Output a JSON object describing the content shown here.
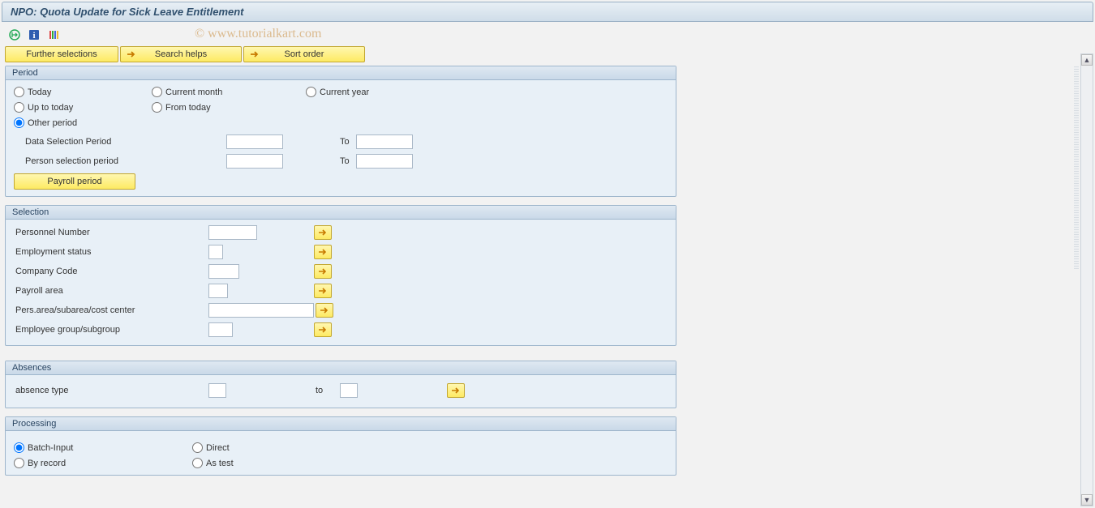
{
  "title": "NPO: Quota Update for Sick Leave Entitlement",
  "watermark": "© www.tutorialkart.com",
  "top_buttons": {
    "further_selections": "Further selections",
    "search_helps": "Search helps",
    "sort_order": "Sort order"
  },
  "period": {
    "title": "Period",
    "today": "Today",
    "current_month": "Current month",
    "current_year": "Current year",
    "up_to_today": "Up to today",
    "from_today": "From today",
    "other_period": "Other period",
    "data_selection": "Data Selection Period",
    "person_selection": "Person selection period",
    "to": "To",
    "payroll_period": "Payroll period"
  },
  "selection": {
    "title": "Selection",
    "personnel_number": "Personnel Number",
    "employment_status": "Employment status",
    "company_code": "Company Code",
    "payroll_area": "Payroll area",
    "pers_area": "Pers.area/subarea/cost center",
    "employee_group": "Employee group/subgroup"
  },
  "absences": {
    "title": "Absences",
    "absence_type": "absence type",
    "to": "to"
  },
  "processing": {
    "title": "Processing",
    "batch_input": "Batch-Input",
    "direct": "Direct",
    "by_record": "By record",
    "as_test": "As test"
  }
}
